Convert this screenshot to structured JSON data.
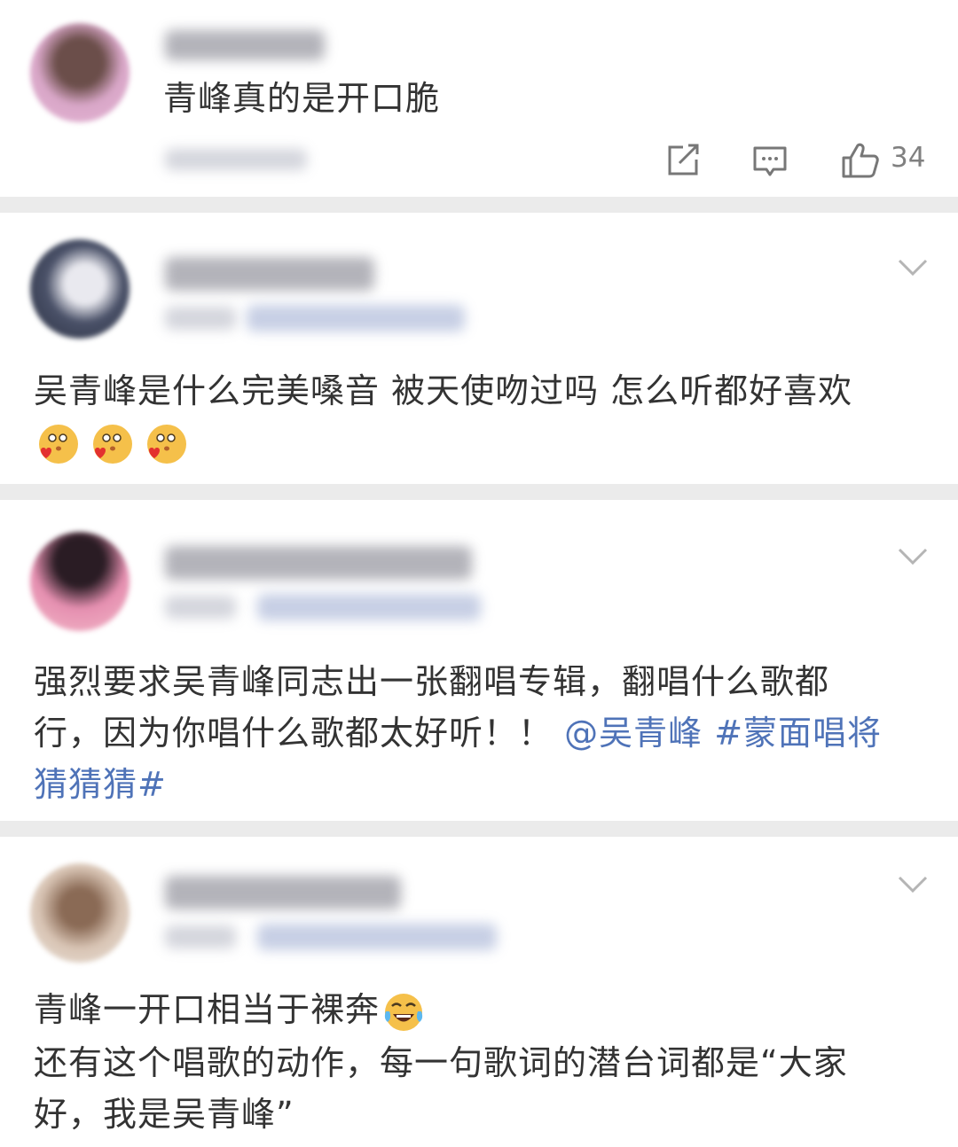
{
  "comments": [
    {
      "text": "青峰真的是开口脆",
      "likes": "34",
      "icons": [
        "share-icon",
        "comment-icon",
        "like-icon"
      ]
    },
    {
      "text_line1": "吴青峰是什么完美嗓音 被天使吻过吗 怎么听都好喜欢",
      "emojis": [
        "kiss-heart-emoji",
        "kiss-heart-emoji",
        "kiss-heart-emoji"
      ]
    },
    {
      "line1": "强烈要求吴青峰同志出一张翻唱专辑，翻唱什么歌都",
      "line2_plain": "行，因为你唱什么歌都太好听！！",
      "mention": "@吴青峰",
      "topic_part1": "#蒙面唱将",
      "topic_part2": "猜猜猜#"
    },
    {
      "line1": "青峰一开口相当于裸奔",
      "line1_emoji": "tears-of-joy-emoji",
      "line2": "还有这个唱歌的动作，每一句歌词的潜台词都是“大家",
      "line3": "好，我是吴青峰”"
    }
  ],
  "colors": {
    "text": "#333333",
    "link": "#4f73b8",
    "divider": "#ebebeb",
    "meta": "#808080"
  }
}
